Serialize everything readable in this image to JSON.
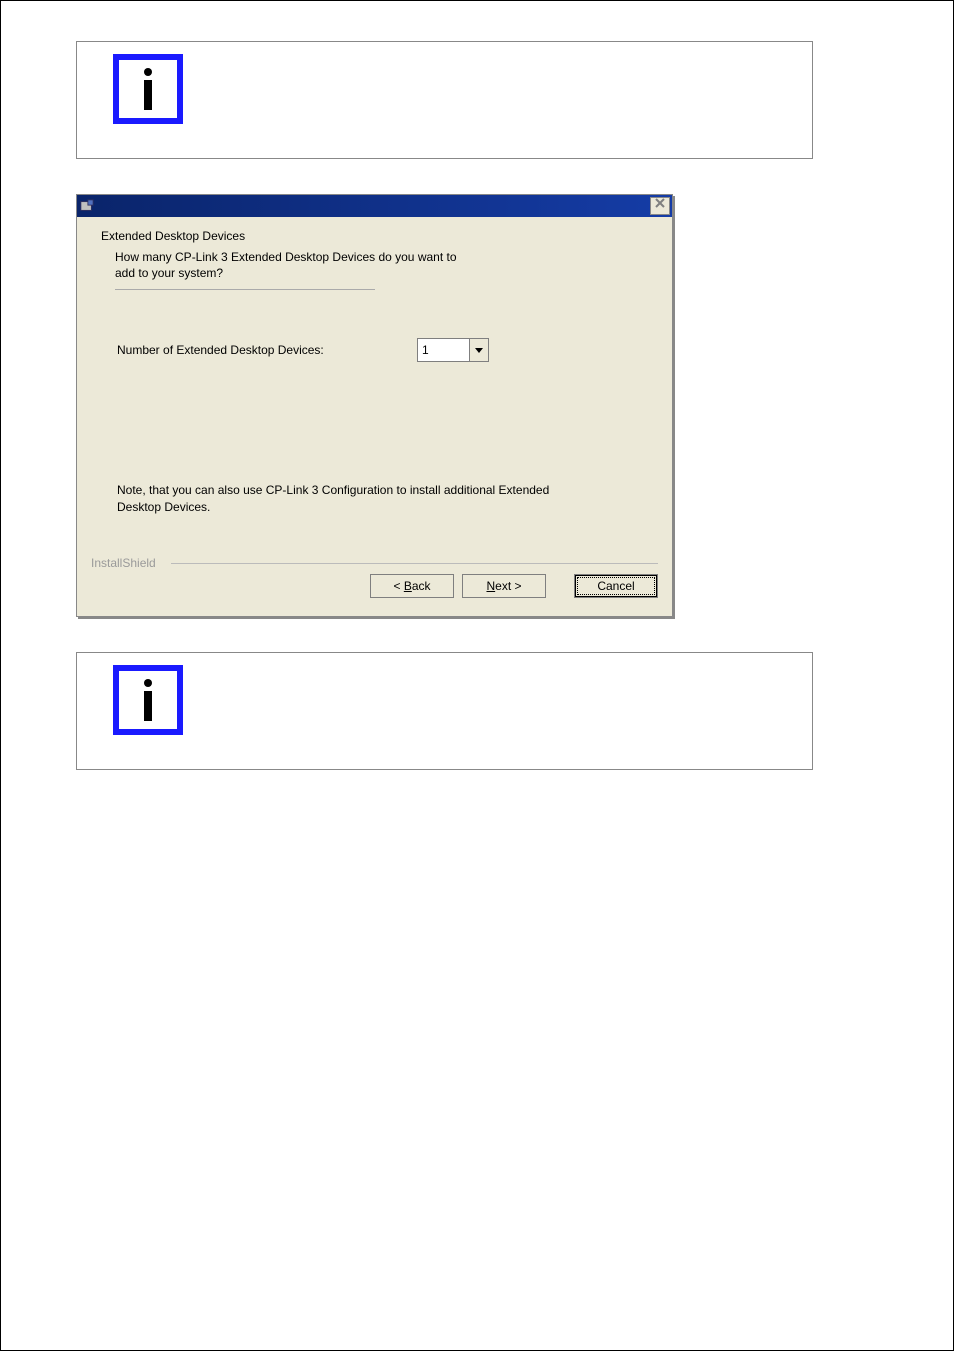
{
  "notes": {
    "top": "",
    "bottom": ""
  },
  "dialog": {
    "title": "Extended Desktop Devices",
    "subtitle": "How many CP-Link 3 Extended Desktop Devices do you want to add to your system?",
    "field_label": "Number of Extended Desktop Devices:",
    "field_value": "1",
    "body_note": "Note, that you can also use CP-Link 3 Configuration to install additional Extended Desktop Devices.",
    "brand": "InstallShield",
    "buttons": {
      "back_prefix": "< ",
      "back_ul": "B",
      "back_suffix": "ack",
      "next_ul": "N",
      "next_suffix": "ext >",
      "cancel": "Cancel"
    }
  }
}
